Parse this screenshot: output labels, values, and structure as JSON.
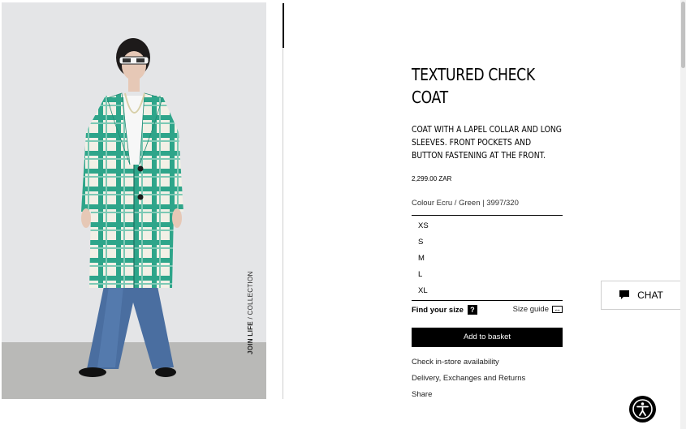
{
  "product": {
    "title": "TEXTURED CHECK COAT",
    "description": "COAT WITH A LAPEL COLLAR AND LONG SLEEVES. FRONT POCKETS AND BUTTON FASTENING AT THE FRONT.",
    "price": "2,299.00 ZAR",
    "colour": "Colour Ecru / Green | 3997/320"
  },
  "image": {
    "caption_bold": "JOIN LIFE",
    "caption_rest": " / COLLECTION"
  },
  "sizes": [
    "XS",
    "S",
    "M",
    "L",
    "XL"
  ],
  "find_size": {
    "label": "Find your size",
    "help": "?"
  },
  "size_guide": {
    "label": "Size guide",
    "icon": "ruler-icon"
  },
  "add_to_basket": "Add to basket",
  "links": {
    "store": "Check in-store availability",
    "delivery": "Delivery, Exchanges and Returns",
    "share": "Share"
  },
  "chat": {
    "label": "CHAT",
    "icon": "chat-icon"
  },
  "accessibility": {
    "icon": "accessibility-icon"
  },
  "colors": {
    "accent": "#000000",
    "coat_green": "#2a9d84"
  }
}
